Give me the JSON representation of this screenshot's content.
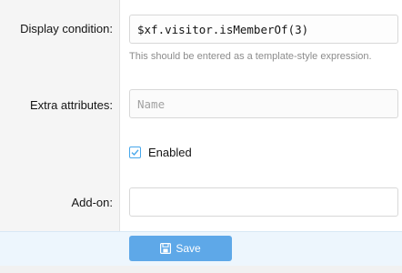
{
  "form": {
    "display_condition": {
      "label": "Display condition:",
      "value": "$xf.visitor.isMemberOf(3)",
      "hint": "This should be entered as a template-style expression."
    },
    "extra_attributes": {
      "label": "Extra attributes:",
      "placeholder": "Name",
      "value": ""
    },
    "enabled": {
      "label": "Enabled",
      "checked": true
    },
    "addon": {
      "label": "Add-on:",
      "value": ""
    }
  },
  "footer": {
    "save_label": "Save"
  },
  "colors": {
    "accent": "#5ea8e8",
    "checkbox_border": "#47a7eb"
  },
  "icons": {
    "save": "floppy-disk-icon",
    "check": "checkmark-icon"
  }
}
